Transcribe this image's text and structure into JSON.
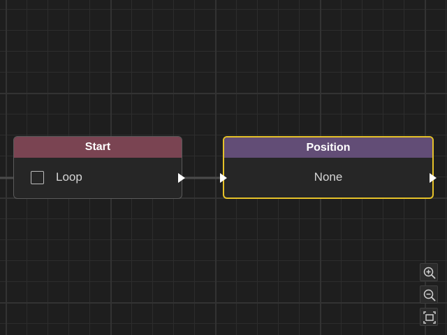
{
  "graph": {
    "nodes": [
      {
        "id": "start",
        "header_label": "Start",
        "header_color": "#7a4452",
        "checkbox_checked": false,
        "checkbox_label": "Loop"
      },
      {
        "id": "position",
        "header_label": "Position",
        "header_color": "#624d76",
        "value_label": "None",
        "selected": true,
        "selection_color": "#e6c229"
      }
    ]
  },
  "toolbar": {
    "buttons": [
      "zoom-in-icon",
      "zoom-out-icon",
      "fit-view-icon"
    ]
  }
}
